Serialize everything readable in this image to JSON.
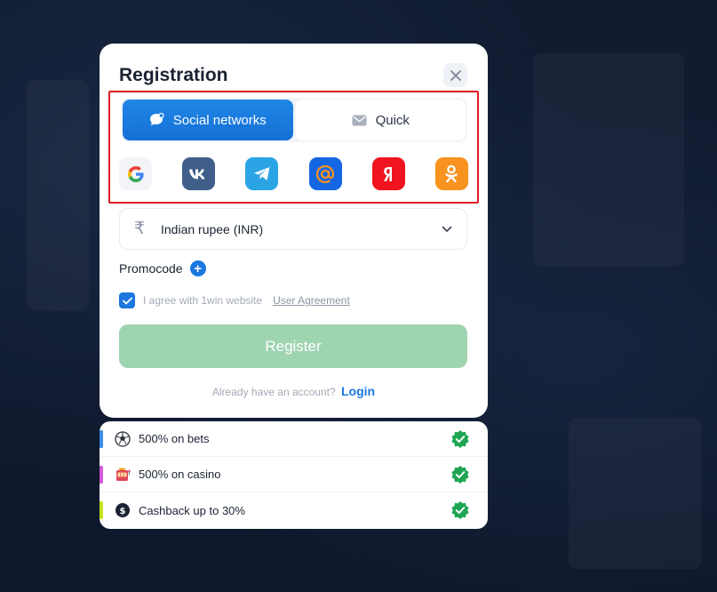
{
  "modal": {
    "title": "Registration",
    "tabs": [
      {
        "label": "Social networks",
        "icon": "chat-bubble-icon",
        "active": true
      },
      {
        "label": "Quick",
        "icon": "envelope-icon",
        "active": false
      }
    ],
    "social_providers": [
      {
        "name": "google",
        "glyph": "G"
      },
      {
        "name": "vk",
        "glyph": "vk"
      },
      {
        "name": "telegram",
        "glyph": ""
      },
      {
        "name": "mailru",
        "glyph": "@"
      },
      {
        "name": "yandex",
        "glyph": "Я"
      },
      {
        "name": "odnoklassniki",
        "glyph": ""
      }
    ],
    "currency": {
      "symbol": "₹",
      "label": "Indian rupee (INR)"
    },
    "promocode_label": "Promocode",
    "agreement": {
      "text": "I agree with 1win website",
      "link": "User Agreement",
      "checked": true
    },
    "register_label": "Register",
    "login_prompt": "Already have an account?",
    "login_link": "Login"
  },
  "bonuses": [
    {
      "text": "500% on bets",
      "icon": "soccer-ball-icon",
      "stripe": "#3b8ee8"
    },
    {
      "text": "500% on casino",
      "icon": "slot-machine-icon",
      "stripe": "#d35ad9"
    },
    {
      "text": "Cashback up to 30%",
      "icon": "cashback-coin-icon",
      "stripe": "#c9e21c"
    }
  ],
  "colors": {
    "accent": "#1b78e0",
    "register": "#9fd4b1",
    "highlight": "#e01b24",
    "check": "#1ea653"
  }
}
